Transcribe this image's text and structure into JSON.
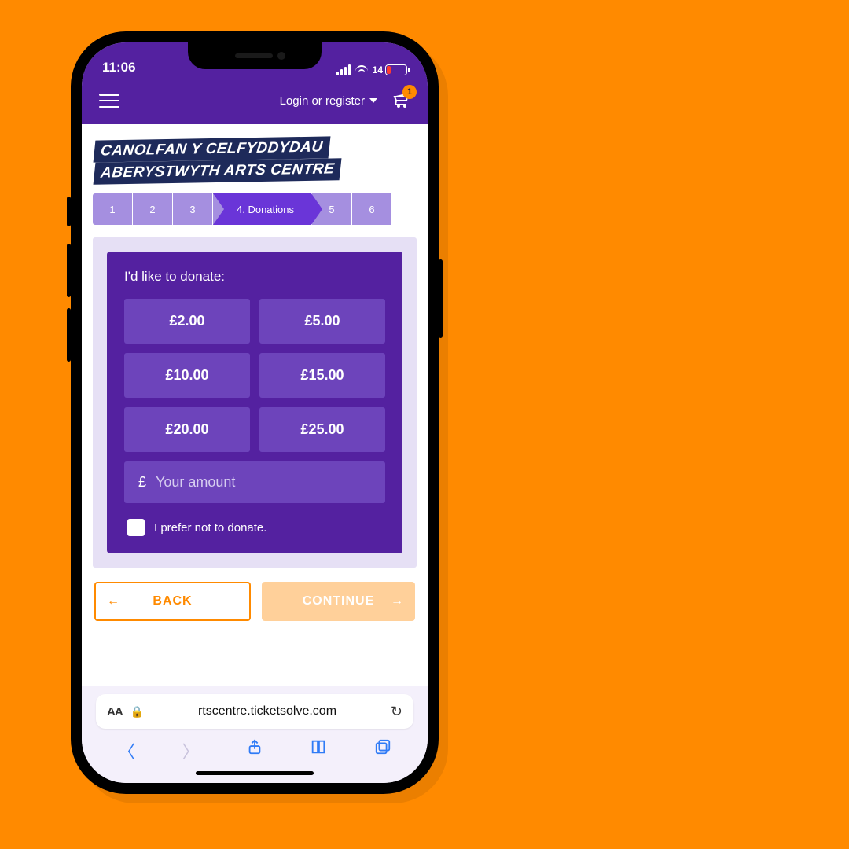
{
  "status": {
    "time": "11:06",
    "battery_text": "14"
  },
  "header": {
    "login_label": "Login or register",
    "cart_badge": "1"
  },
  "brand": {
    "line1": "CANOLFAN Y CELFYDDYDAU",
    "line2": "ABERYSTWYTH ARTS CENTRE"
  },
  "progress": {
    "steps": [
      "1",
      "2",
      "3",
      "4. Donations",
      "5",
      "6"
    ],
    "active_index": 3
  },
  "donate": {
    "title": "I'd like to donate:",
    "amounts": [
      "£2.00",
      "£5.00",
      "£10.00",
      "£15.00",
      "£20.00",
      "£25.00"
    ],
    "currency": "£",
    "custom_placeholder": "Your amount",
    "prefer_label": "I prefer not to donate."
  },
  "nav": {
    "back": "BACK",
    "continue": "CONTINUE",
    "ghost": "Continue"
  },
  "safari": {
    "aa": "AA",
    "url": "rtscentre.ticketsolve.com"
  }
}
